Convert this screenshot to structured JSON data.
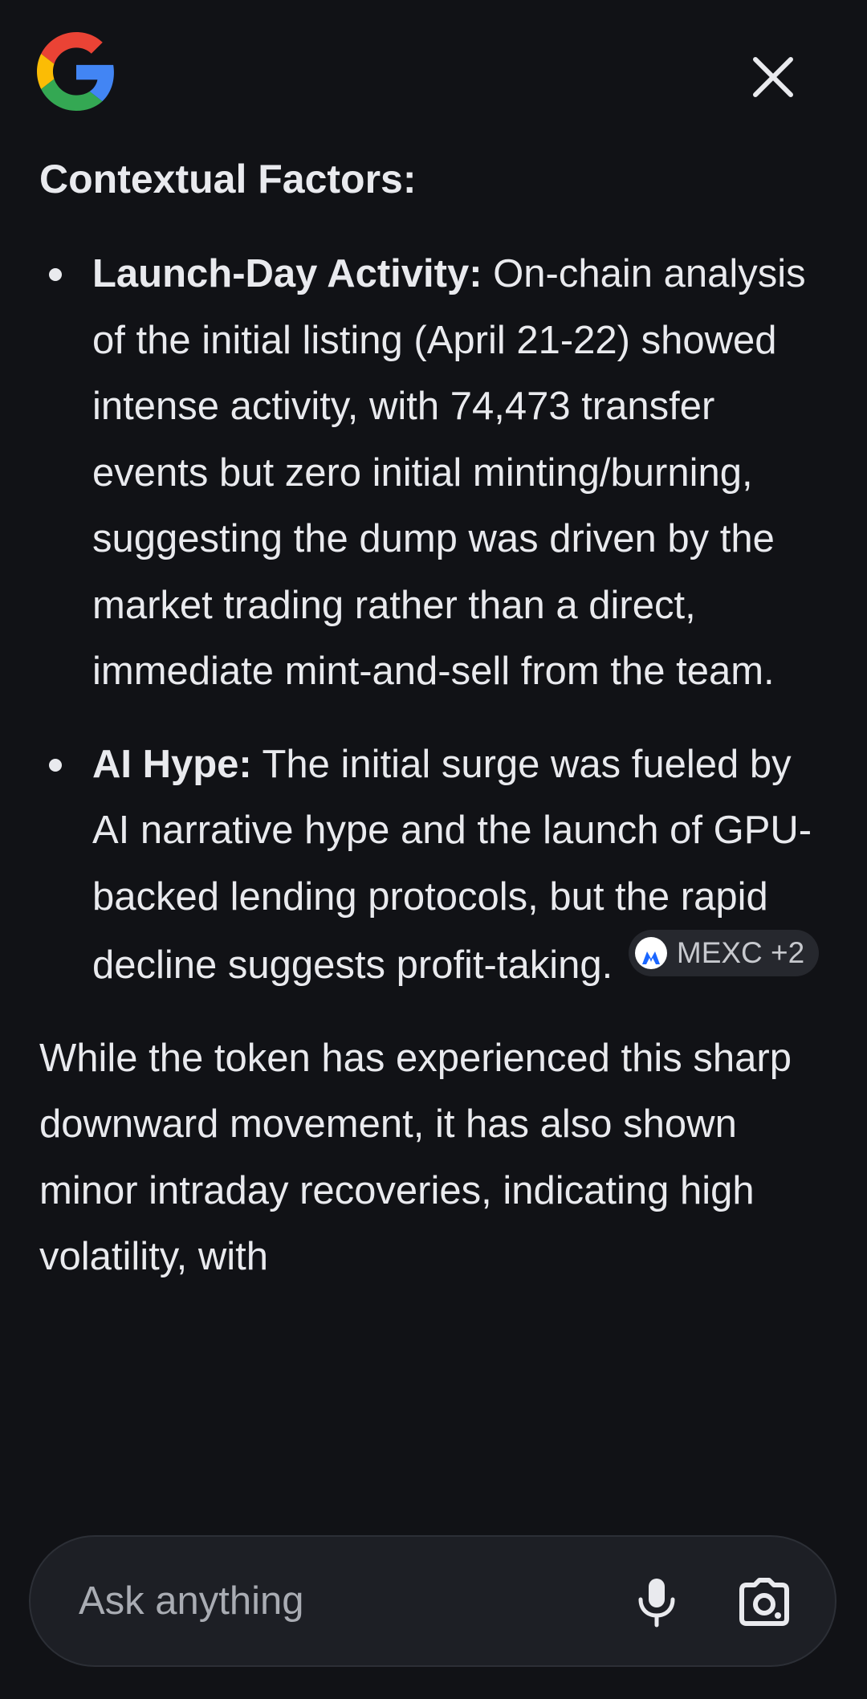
{
  "header": {
    "logo_icon": "google-g-logo",
    "close_icon": "close-icon"
  },
  "content": {
    "heading": "Contextual Factors:",
    "bullets": [
      {
        "term": "Launch-Day Activity:",
        "text": " On-chain analysis of the initial listing (April 21-22) showed intense activity, with 74,473 transfer events but zero initial minting/burning, suggesting the dump was driven by the market trading rather than a direct, immediate mint-and-sell from the team."
      },
      {
        "term": "AI Hype:",
        "text": " The initial surge was fueled by AI narrative hype and the launch of GPU-backed lending protocols, but the rapid decline suggests profit-taking.",
        "source_chip": {
          "label": "MEXC +2",
          "icon": "mexc-logo-icon"
        }
      }
    ],
    "paragraph": "While the token has experienced this sharp downward movement, it has also shown minor intraday recoveries, indicating high volatility, with"
  },
  "ask_bar": {
    "placeholder": "Ask anything",
    "mic_icon": "microphone-icon",
    "lens_icon": "lens-camera-icon"
  },
  "colors": {
    "background": "#111216",
    "text": "#e9eaee",
    "chip_background": "#26282e",
    "ask_bar_background": "#1d1f25",
    "google_blue": "#4285F4",
    "google_red": "#EA4335",
    "google_yellow": "#FBBC05",
    "google_green": "#34A853",
    "mexc_blue": "#1a66ff"
  }
}
